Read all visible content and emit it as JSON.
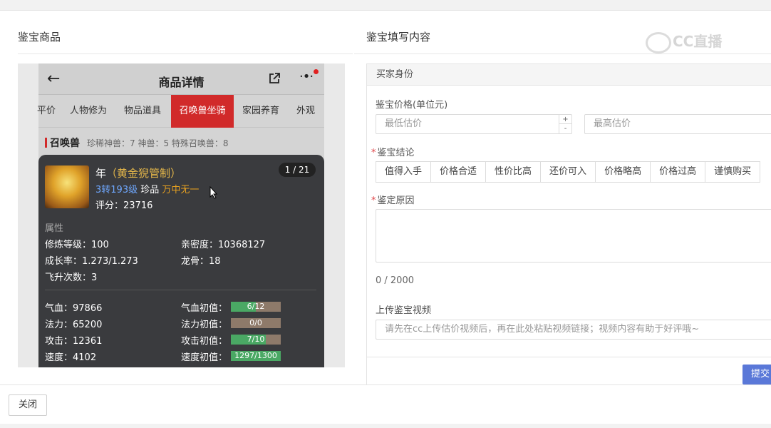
{
  "left_title": "鉴宝商品",
  "right_title": "鉴宝填写内容",
  "watermark": "CC直播",
  "phone": {
    "title": "商品详情",
    "tabs": [
      "平价",
      "人物修为",
      "物品道具",
      "召唤兽坐骑",
      "家园养育",
      "外观"
    ],
    "active_tab": "召唤兽坐骑",
    "section": {
      "name": "召唤兽",
      "stats": "珍稀神兽：7  神兽：5  特殊召唤兽：8"
    },
    "pet": {
      "name_prefix": "年",
      "name_suffix": "（黄金猊管制）",
      "level": "3转193级",
      "grade": "珍品",
      "tag": "万中无一",
      "score": "评分：23716",
      "pager": "1 / 21"
    },
    "attr_header": "属性",
    "attrs": [
      "修炼等级：100",
      "亲密度：10368127",
      "成长率：1.273/1.273",
      "龙骨：18",
      "飞升次数：3"
    ],
    "stats": [
      {
        "label": "气血：97866",
        "init_label": "气血初值：",
        "bar": "6/12",
        "fraction": 0.5
      },
      {
        "label": "法力：65200",
        "init_label": "法力初值：",
        "bar": "0/0",
        "fraction": 0.0
      },
      {
        "label": "攻击：12361",
        "init_label": "攻击初值：",
        "bar": "7/10",
        "fraction": 0.7
      },
      {
        "label": "速度：4102",
        "init_label": "速度初值：",
        "bar": "1297/1300",
        "fraction": 0.998
      }
    ]
  },
  "form": {
    "header": "买家身份",
    "price_label": "鉴宝价格(单位元)",
    "min_placeholder": "最低估价",
    "max_placeholder": "最高估价",
    "stepper_plus": "+",
    "stepper_minus": "-",
    "conclusion_label": "鉴宝结论",
    "required_mark": "*",
    "conclusions": [
      "值得入手",
      "价格合适",
      "性价比高",
      "还价可入",
      "价格略高",
      "价格过高",
      "谨慎购买"
    ],
    "reason_label": "鉴定原因",
    "counter": "0 / 2000",
    "video_label": "上传鉴宝视频",
    "video_placeholder": "请先在cc上传估价视频后，再在此处粘贴视频链接；视频内容有助于好评哦~",
    "submit": "提交"
  },
  "close": "关闭"
}
